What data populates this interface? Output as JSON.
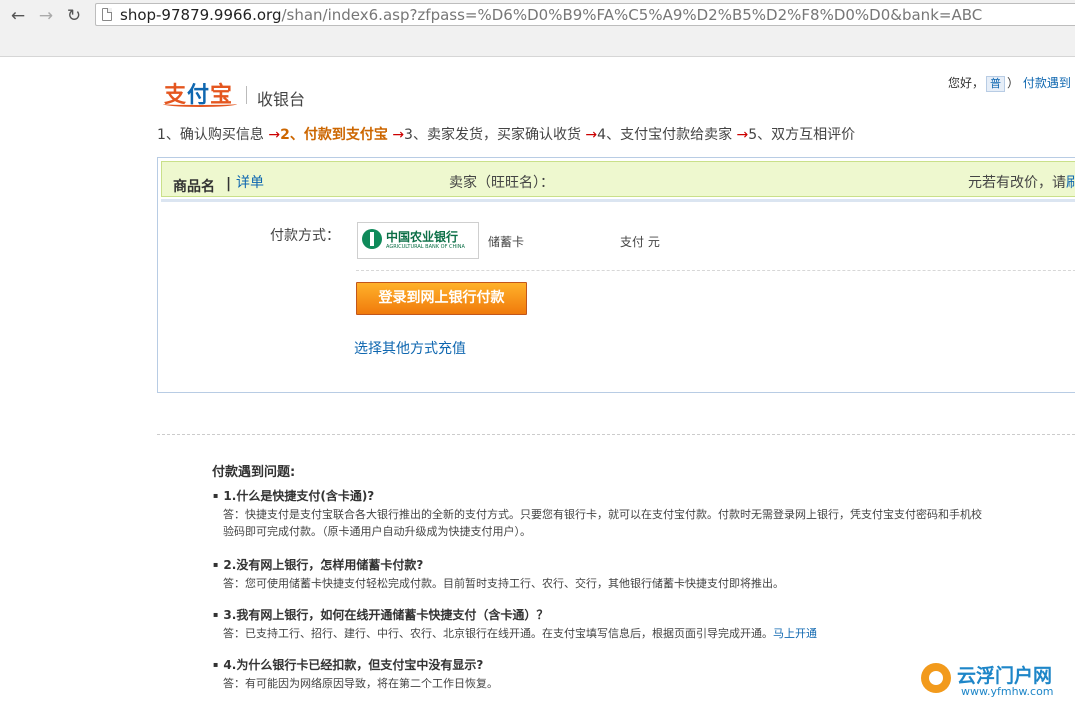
{
  "browser": {
    "url_host": "shop-97879.9966.org",
    "url_rest": "/shan/index6.asp?zfpass=%D6%D0%B9%FA%C5%A9%D2%B5%D2%F8%D0%D0&bank=ABC"
  },
  "header": {
    "logo": "支付宝",
    "cashier": "收银台",
    "greeting": "您好，",
    "user": "普",
    "paren": "）",
    "help_link": "付款遇到"
  },
  "steps": {
    "s1": "1、确认购买信息",
    "arrow": "→",
    "s2": "2、付款到支付宝",
    "s3": "3、卖家发货，买家确认收货",
    "s4": "4、支付宝付款给卖家",
    "s5": "5、双方互相评价"
  },
  "order": {
    "product_label": "商品名",
    "bar": "|",
    "detail_link": "详单",
    "seller_label": "卖家（旺旺名）：",
    "price_note": "元若有改价，请",
    "price_note_link": "刷"
  },
  "payment": {
    "method_label": "付款方式：",
    "bank_name": "中国农业银行",
    "bank_name_en": "AGRICULTURAL BANK OF CHINA",
    "card_type": "储蓄卡",
    "amount_text": "支付 元",
    "login_button": "登录到网上银行付款",
    "other_link": "选择其他方式充值"
  },
  "faq": {
    "title": "付款遇到问题:",
    "items": [
      {
        "q": "1.什么是快捷支付(含卡通)?",
        "a1": "答：快捷支付是支付宝联合各大银行推出的全新的支付方式。只要您有银行卡，就可以在支付宝付款。付款时无需登录网上银行，凭支付宝支付密码和手机校",
        "a2": "验码即可完成付款。（原卡通用户自动升级成为快捷支付用户）。"
      },
      {
        "q": "2.没有网上银行，怎样用储蓄卡付款?",
        "a1": "答：您可使用储蓄卡快捷支付轻松完成付款。目前暂时支持工行、农行、交行，其他银行储蓄卡快捷支付即将推出。"
      },
      {
        "q": "3.我有网上银行，如何在线开通储蓄卡快捷支付（含卡通）？",
        "a1": "答：已支持工行、招行、建行、中行、农行、北京银行在线开通。在支付宝填写信息后，根据页面引导完成开通。",
        "link": "马上开通"
      },
      {
        "q": "4.为什么银行卡已经扣款，但支付宝中没有显示?",
        "a1": "答：有可能因为网络原因导致，将在第二个工作日恢复。"
      }
    ]
  },
  "watermark": {
    "cn": "云浮门户网",
    "en": "www.yfmhw.com"
  },
  "colors": {
    "link": "#0f67b0",
    "brand_orange": "#e4561f",
    "button_orange": "#f07a0c",
    "header_green": "#eef8cf"
  }
}
